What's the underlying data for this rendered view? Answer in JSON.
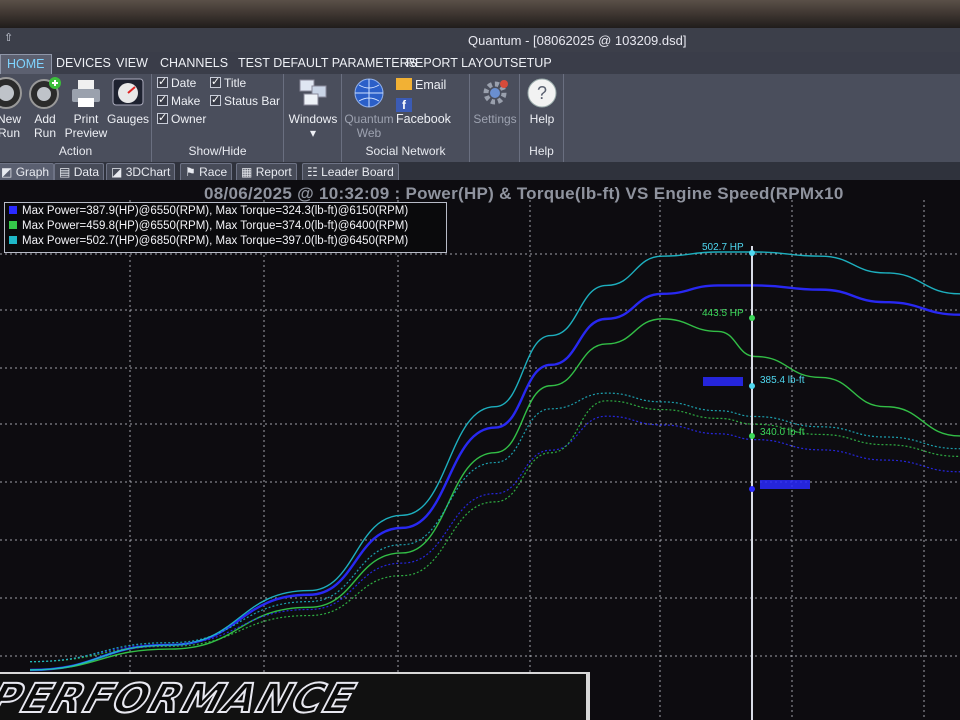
{
  "window": {
    "title": "Quantum - [08062025 @ 103209.dsd]",
    "menu_glyph": "⇧"
  },
  "ribbon_tabs": [
    "HOME",
    "DEVICES",
    "VIEW",
    "CHANNELS",
    "TEST DEFAULT PARAMETERS",
    "REPORT LAYOUT",
    "SETUP"
  ],
  "ribbon": {
    "action": {
      "label": "Action",
      "new_run_l1": "New",
      "new_run_l2": "Run",
      "add_run_l1": "Add",
      "add_run_l2": "Run",
      "print_l1": "Print",
      "print_l2": "Preview",
      "gauges": "Gauges"
    },
    "showhide": {
      "label": "Show/Hide",
      "checks": [
        "Date",
        "Make",
        "Owner",
        "Title",
        "Status Bar"
      ],
      "windows": "Windows"
    },
    "social": {
      "label": "Social Network",
      "quantum_web_l1": "Quantum",
      "quantum_web_l2": "Web",
      "email": "Email",
      "facebook": "Facebook",
      "settings": "Settings"
    },
    "help": {
      "label": "Help",
      "button": "Help"
    }
  },
  "doc_tabs": [
    "Graph",
    "Data",
    "3DChart",
    "Race",
    "Report",
    "Leader Board"
  ],
  "colors": {
    "run1": "#2a2aff",
    "run2": "#35c84a",
    "run3": "#1fb8c8",
    "grid": "#cfd3dc",
    "cursor": "#d8dce6"
  },
  "chart_data": {
    "type": "line",
    "title": "08/06/2025 @ 10:32:09 : Power(HP) & Torque(lb-ft) VS Engine Speed(RPMx10",
    "legend": [
      "Max Power=387.9(HP)@6550(RPM), Max Torque=324.3(lb-ft)@6150(RPM)",
      "Max Power=459.8(HP)@6550(RPM), Max Torque=374.0(lb-ft)@6400(RPM)",
      "Max Power=502.7(HP)@6850(RPM), Max Torque=397.0(lb-ft)@6450(RPM)"
    ],
    "cursor_labels": [
      {
        "text": "502.7 HP",
        "color": "#4fd8f0"
      },
      {
        "text": "443.5 HP",
        "color": "#3cd65a"
      },
      {
        "text": "385.4 lb-ft",
        "color": "#4fd8f0"
      },
      {
        "text": "340.0 lb-ft",
        "color": "#3cd65a"
      }
    ],
    "series": [
      {
        "x": [
          0,
          0.15,
          0.3,
          0.4,
          0.5,
          0.56,
          0.62,
          0.68,
          0.74,
          0.78,
          0.85,
          0.92,
          1
        ],
        "values": [
          0,
          0.06,
          0.18,
          0.34,
          0.58,
          0.73,
          0.84,
          0.9,
          0.92,
          0.92,
          0.91,
          0.88,
          0.85
        ]
      },
      {
        "x": [
          0,
          0.15,
          0.3,
          0.4,
          0.5,
          0.56,
          0.62,
          0.68,
          0.74,
          0.78,
          0.85,
          0.92,
          1
        ],
        "values": [
          0,
          0.05,
          0.15,
          0.28,
          0.52,
          0.68,
          0.78,
          0.84,
          0.81,
          0.75,
          0.7,
          0.63,
          0.56
        ]
      },
      {
        "x": [
          0,
          0.15,
          0.3,
          0.4,
          0.5,
          0.56,
          0.62,
          0.68,
          0.74,
          0.78,
          0.85,
          0.92,
          1
        ],
        "values": [
          0,
          0.06,
          0.19,
          0.37,
          0.63,
          0.8,
          0.92,
          0.99,
          1.0,
          1.0,
          0.99,
          0.95,
          0.9
        ]
      }
    ]
  },
  "brand": {
    "text": "PERFORMANCE"
  }
}
